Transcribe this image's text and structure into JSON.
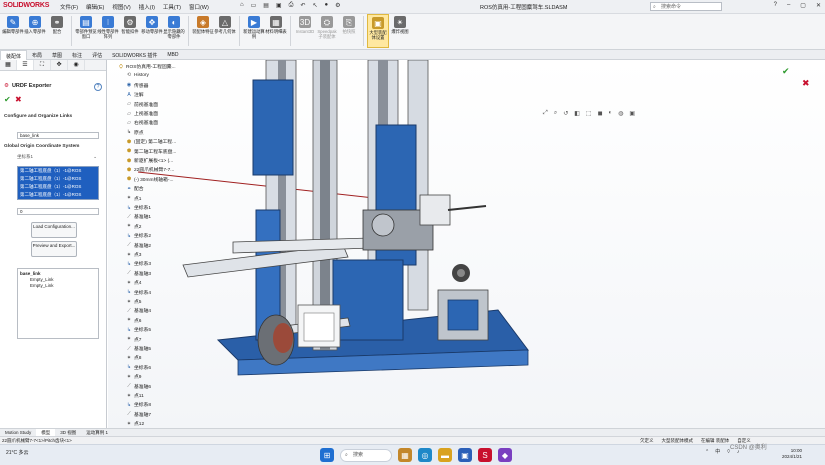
{
  "app": {
    "logo": "SOLIDWORKS",
    "document_title": "ROS仿真用-工程固麋驾车.SLDASM",
    "search_placeholder": "搜索命令"
  },
  "menu": [
    "文件(F)",
    "编辑(E)",
    "视图(V)",
    "插入(I)",
    "工具(T)",
    "窗口(W)"
  ],
  "ribbon": [
    {
      "label": "编辑零部件",
      "icon": "edit-component-icon",
      "color": "#3a7bd5"
    },
    {
      "label": "插入零部件",
      "icon": "insert-component-icon",
      "color": "#3a7bd5"
    },
    {
      "label": "配合",
      "icon": "mate-icon",
      "color": "#6b6b6b"
    },
    {
      "label": "零部件预览窗口",
      "icon": "component-preview-icon",
      "color": "#3a7bd5"
    },
    {
      "label": "线性零部件阵列",
      "icon": "linear-pattern-icon",
      "color": "#3a7bd5"
    },
    {
      "label": "智能扣件",
      "icon": "smart-fastener-icon",
      "color": "#6b6b6b"
    },
    {
      "label": "移动零部件",
      "icon": "move-component-icon",
      "color": "#3a7bd5"
    },
    {
      "label": "显示隐藏的零部件",
      "icon": "show-hidden-icon",
      "color": "#3a7bd5"
    },
    {
      "label": "装配体特征",
      "icon": "assembly-feature-icon",
      "color": "#c87a2a"
    },
    {
      "label": "参考几何体",
      "icon": "reference-geometry-icon",
      "color": "#6b6b6b"
    },
    {
      "label": "新建运动算例",
      "icon": "new-motion-study-icon",
      "color": "#3a7bd5"
    },
    {
      "label": "材料明细表",
      "icon": "bom-icon",
      "color": "#6b6b6b"
    },
    {
      "label": "Instant3D",
      "icon": "instant3d-icon",
      "color": "#999999"
    },
    {
      "label": "Speedpak子装配体",
      "icon": "speedpak-icon",
      "color": "#999999"
    },
    {
      "label": "拍快照",
      "icon": "snapshot-icon",
      "color": "#999999"
    },
    {
      "label": "大型装配体设置",
      "icon": "large-assembly-icon",
      "color": "#c89a2a"
    },
    {
      "label": "爆炸视图",
      "icon": "exploded-view-icon",
      "color": "#6b6b6b"
    }
  ],
  "command_tabs": [
    "装配体",
    "布局",
    "草图",
    "标注",
    "评估",
    "SOLIDWORKS 插件",
    "MBD"
  ],
  "property_manager": {
    "title": "URDF Exporter",
    "section_heading": "Configure and Organize Links",
    "link_name": "base_link",
    "global_origin_heading": "Global Origin Coordinate System",
    "coord_system": "坐标系1",
    "components": [
      "第二轴工程底盘（1）-1@ROS",
      "第二轴工程底盘（1）-1@ROS",
      "第二轴工程底盘（1）-1@ROS",
      "第二轴工程底盘（1）-1@ROS"
    ],
    "child_count": "0",
    "load_btn": "Load Configuration...",
    "preview_btn": "Preview and Export...",
    "link_tree": [
      "base_link",
      "Empty_Link",
      "Empty_Link"
    ]
  },
  "feature_tree": [
    {
      "label": "ROS仿真用-工程固麋...",
      "icon": "assembly-icon"
    },
    {
      "label": "History",
      "icon": "history-icon"
    },
    {
      "label": "传感器",
      "icon": "sensor-icon"
    },
    {
      "label": "注解",
      "icon": "annotation-icon"
    },
    {
      "label": "前视基准面",
      "icon": "plane-icon"
    },
    {
      "label": "上视基准面",
      "icon": "plane-icon"
    },
    {
      "label": "右视基准面",
      "icon": "plane-icon"
    },
    {
      "label": "原点",
      "icon": "origin-icon"
    },
    {
      "label": "(固定) 第二轴工程...",
      "icon": "part-icon"
    },
    {
      "label": "第二轴工程车底盘...",
      "icon": "part-icon"
    },
    {
      "label": "新驱扩展板<1> (...",
      "icon": "part-icon"
    },
    {
      "label": "22圆爪机械臂7-7...",
      "icon": "part-icon"
    },
    {
      "label": "(-) 30mm线轴箱-...",
      "icon": "part-icon"
    },
    {
      "label": "配合",
      "icon": "mates-icon"
    },
    {
      "label": "点1",
      "icon": "point-icon"
    },
    {
      "label": "坐标系1",
      "icon": "csys-icon"
    },
    {
      "label": "基准轴1",
      "icon": "axis-icon"
    },
    {
      "label": "点2",
      "icon": "point-icon"
    },
    {
      "label": "坐标系2",
      "icon": "csys-icon"
    },
    {
      "label": "基准轴2",
      "icon": "axis-icon"
    },
    {
      "label": "点3",
      "icon": "point-icon"
    },
    {
      "label": "坐标系3",
      "icon": "csys-icon"
    },
    {
      "label": "基准轴3",
      "icon": "axis-icon"
    },
    {
      "label": "点4",
      "icon": "point-icon"
    },
    {
      "label": "坐标系4",
      "icon": "csys-icon"
    },
    {
      "label": "点5",
      "icon": "point-icon"
    },
    {
      "label": "基准轴4",
      "icon": "axis-icon"
    },
    {
      "label": "点6",
      "icon": "point-icon"
    },
    {
      "label": "坐标系5",
      "icon": "csys-icon"
    },
    {
      "label": "点7",
      "icon": "point-icon"
    },
    {
      "label": "基准轴5",
      "icon": "axis-icon"
    },
    {
      "label": "点8",
      "icon": "point-icon"
    },
    {
      "label": "坐标系6",
      "icon": "csys-icon"
    },
    {
      "label": "点9",
      "icon": "point-icon"
    },
    {
      "label": "基准轴6",
      "icon": "axis-icon"
    },
    {
      "label": "点11",
      "icon": "point-icon"
    },
    {
      "label": "坐标系8",
      "icon": "csys-icon"
    },
    {
      "label": "基准轴7",
      "icon": "axis-icon"
    },
    {
      "label": "点12",
      "icon": "point-icon"
    }
  ],
  "bottom_tabs": [
    "Motion Study",
    "模型",
    "3D 视图",
    "运动算例 1"
  ],
  "status": {
    "left": "22圆爪机械臂7-7<1>/Pitch齿块<1>",
    "items": [
      "欠定义",
      "大型装配体模式",
      "在编辑 装配体",
      "自定义"
    ]
  },
  "taskbar": {
    "weather": "21°C 多云",
    "search": "搜索",
    "time": "10:00",
    "date": "2024/1/21",
    "lang": "中"
  },
  "watermark": "CSDN @奥利"
}
